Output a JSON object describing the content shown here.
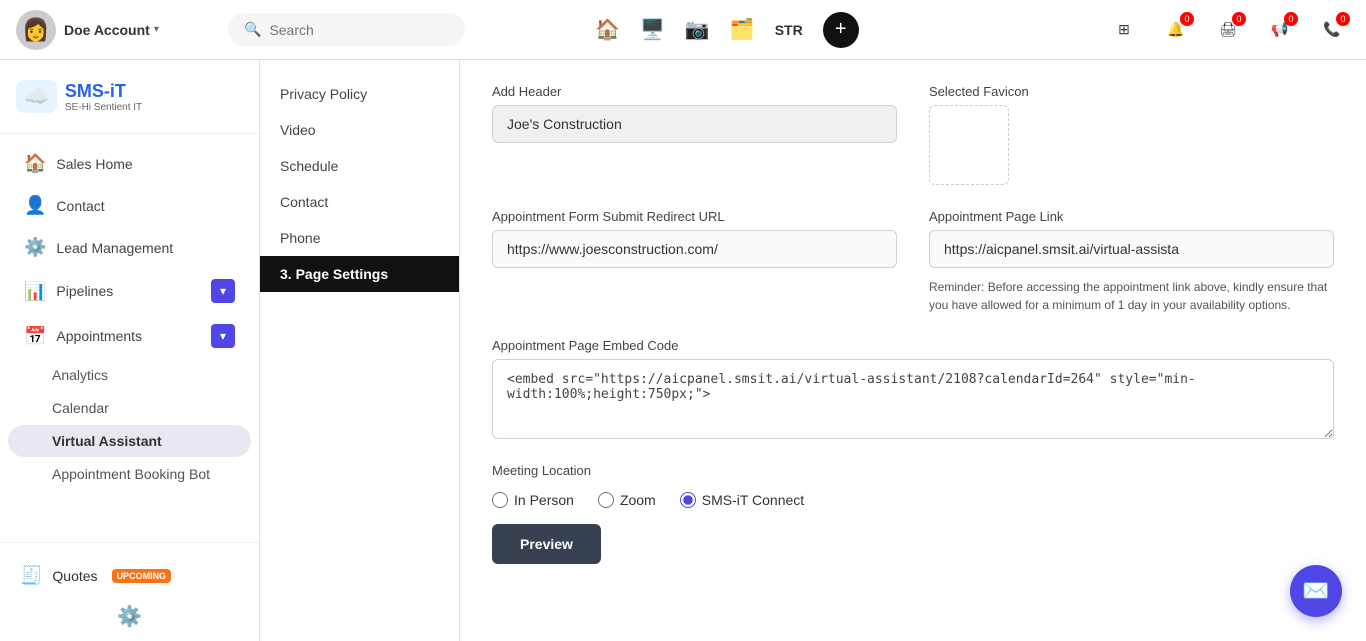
{
  "topNav": {
    "accountName": "Doe Account",
    "searchPlaceholder": "Search",
    "plusLabel": "+",
    "strLabel": "STR",
    "navIcons": [
      {
        "name": "grid-icon",
        "symbol": "⊞",
        "badge": null
      },
      {
        "name": "bell-icon",
        "symbol": "🔔",
        "badge": "0"
      },
      {
        "name": "print-icon",
        "symbol": "🖨",
        "badge": "0"
      },
      {
        "name": "megaphone-icon",
        "symbol": "📢",
        "badge": "0"
      },
      {
        "name": "phone-icon",
        "symbol": "📞",
        "badge": "0"
      }
    ]
  },
  "sidebar": {
    "logoText": "SMS-iT",
    "logoSub": "SE-Hi Sentient IT",
    "menuItems": [
      {
        "id": "sales-home",
        "label": "Sales Home",
        "icon": "🏠",
        "hasArrow": false
      },
      {
        "id": "contact",
        "label": "Contact",
        "icon": "👤",
        "hasArrow": false
      },
      {
        "id": "lead-management",
        "label": "Lead Management",
        "icon": "⚙️",
        "hasArrow": false
      },
      {
        "id": "pipelines",
        "label": "Pipelines",
        "icon": "📊",
        "hasArrow": true
      },
      {
        "id": "appointments",
        "label": "Appointments",
        "icon": "📅",
        "hasArrow": true
      }
    ],
    "subMenuItems": [
      {
        "id": "analytics",
        "label": "Analytics",
        "active": false
      },
      {
        "id": "calendar",
        "label": "Calendar",
        "active": false
      },
      {
        "id": "virtual-assistant",
        "label": "Virtual Assistant",
        "active": true
      },
      {
        "id": "appointment-booking-bot",
        "label": "Appointment Booking Bot",
        "active": false
      }
    ],
    "quotesItem": {
      "label": "Quotes",
      "icon": "🧾",
      "badge": "UPCOMING"
    }
  },
  "secondaryPanel": {
    "items": [
      {
        "id": "privacy",
        "label": "Privacy Policy",
        "active": false
      },
      {
        "id": "video",
        "label": "Video",
        "active": false
      },
      {
        "id": "schedule",
        "label": "Schedule",
        "active": false
      },
      {
        "id": "contact",
        "label": "Contact",
        "active": false
      },
      {
        "id": "phone",
        "label": "Phone",
        "active": false
      },
      {
        "id": "page-settings",
        "label": "3. Page Settings",
        "active": true
      }
    ]
  },
  "pageSettings": {
    "addHeaderLabel": "Add Header",
    "addHeaderValue": "Joe's Construction",
    "selectedFaviconLabel": "Selected Favicon",
    "appointmentFormUrlLabel": "Appointment Form Submit Redirect URL",
    "appointmentFormUrl": "https://www.joesconstruction.com/",
    "appointmentPageLinkLabel": "Appointment Page Link",
    "appointmentPageLink": "https://aicpanel.smsit.ai/virtual-assista",
    "reminderText": "Reminder: Before accessing the appointment link above, kindly ensure that you have allowed for a minimum of 1 day in your availability options.",
    "embedCodeLabel": "Appointment Page Embed Code",
    "embedCode": "<embed src=\"https://aicpanel.smsit.ai/virtual-assistant/2108?calendarId=264\" style=\"min-width:100%;height:750px;\">",
    "meetingLocationLabel": "Meeting Location",
    "meetingOptions": [
      {
        "id": "in-person",
        "label": "In Person",
        "checked": false
      },
      {
        "id": "zoom",
        "label": "Zoom",
        "checked": false
      },
      {
        "id": "smsit-connect",
        "label": "SMS-iT Connect",
        "checked": true
      }
    ],
    "previewButtonLabel": "Preview"
  }
}
